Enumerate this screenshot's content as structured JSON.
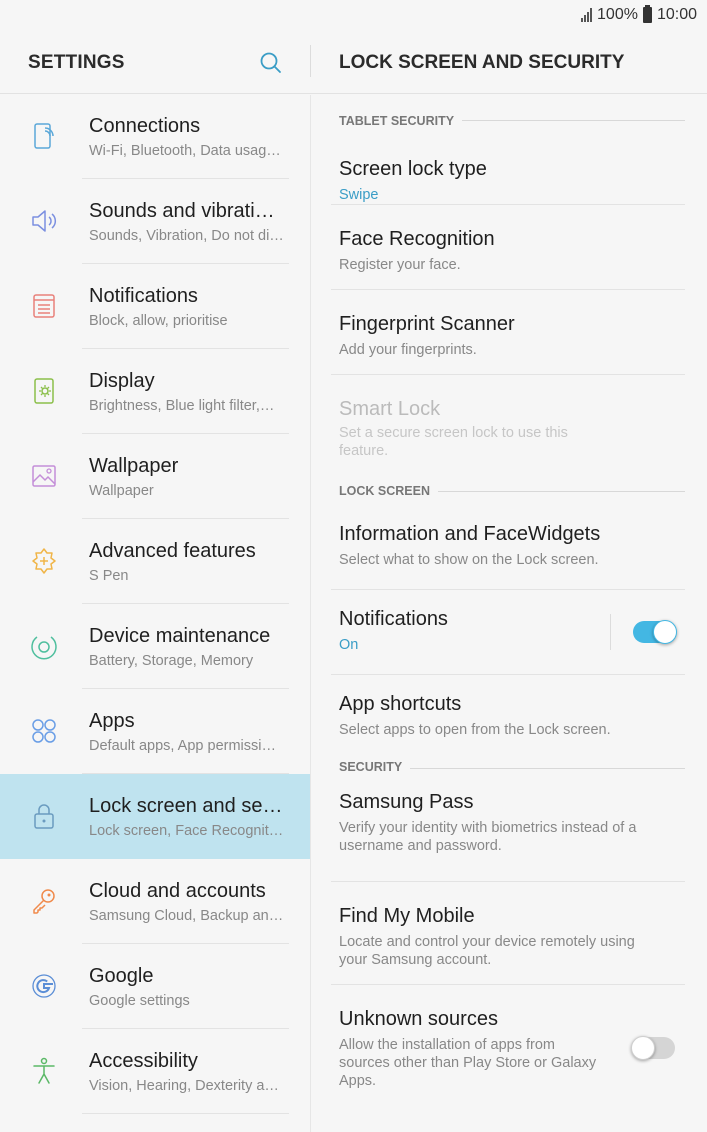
{
  "status_bar": {
    "battery": "100%",
    "time": "10:00"
  },
  "left_panel": {
    "title": "SETTINGS",
    "items": [
      {
        "title": "Connections",
        "subtitle": "Wi-Fi, Bluetooth, Data usag…",
        "icon": "connections-icon"
      },
      {
        "title": "Sounds and vibrati…",
        "subtitle": "Sounds, Vibration, Do not di…",
        "icon": "speaker-icon"
      },
      {
        "title": "Notifications",
        "subtitle": "Block, allow, prioritise",
        "icon": "notifications-icon"
      },
      {
        "title": "Display",
        "subtitle": "Brightness, Blue light filter,…",
        "icon": "display-icon"
      },
      {
        "title": "Wallpaper",
        "subtitle": "Wallpaper",
        "icon": "wallpaper-icon"
      },
      {
        "title": "Advanced features",
        "subtitle": "S Pen",
        "icon": "advanced-features-icon"
      },
      {
        "title": "Device maintenance",
        "subtitle": "Battery, Storage, Memory",
        "icon": "device-maintenance-icon"
      },
      {
        "title": "Apps",
        "subtitle": "Default apps, App permissi…",
        "icon": "apps-icon"
      },
      {
        "title": "Lock screen and se…",
        "subtitle": "Lock screen, Face Recognit…",
        "icon": "lock-icon"
      },
      {
        "title": "Cloud and accounts",
        "subtitle": "Samsung Cloud, Backup an…",
        "icon": "key-icon"
      },
      {
        "title": "Google",
        "subtitle": "Google settings",
        "icon": "google-icon"
      },
      {
        "title": "Accessibility",
        "subtitle": "Vision, Hearing, Dexterity a…",
        "icon": "accessibility-icon"
      }
    ]
  },
  "right_panel": {
    "title": "LOCK SCREEN AND SECURITY",
    "sections": [
      {
        "header": "TABLET SECURITY",
        "items": [
          {
            "title": "Screen lock type",
            "subtitle": "Swipe"
          },
          {
            "title": "Face Recognition",
            "subtitle": "Register your face."
          },
          {
            "title": "Fingerprint Scanner",
            "subtitle": "Add your fingerprints."
          },
          {
            "title": "Smart Lock",
            "subtitle": "Set a secure screen lock to use this feature."
          }
        ]
      },
      {
        "header": "LOCK SCREEN",
        "items": [
          {
            "title": "Information and FaceWidgets",
            "subtitle": "Select what to show on the Lock screen."
          },
          {
            "title": "Notifications",
            "subtitle": "On",
            "toggle": true
          },
          {
            "title": "App shortcuts",
            "subtitle": "Select apps to open from the Lock screen."
          }
        ]
      },
      {
        "header": "SECURITY",
        "items": [
          {
            "title": "Samsung Pass",
            "subtitle": "Verify your identity with biometrics instead of a username and password."
          },
          {
            "title": "Find My Mobile",
            "subtitle": "Locate and control your device remotely using your Samsung account."
          },
          {
            "title": "Unknown sources",
            "subtitle": "Allow the installation of apps from sources other than Play Store or Galaxy Apps.",
            "toggle": false
          }
        ]
      }
    ]
  },
  "colors": {
    "accent": "#3a9dc6",
    "selected_bg": "#bfe3ef",
    "toggle_on": "#43b7e3"
  }
}
